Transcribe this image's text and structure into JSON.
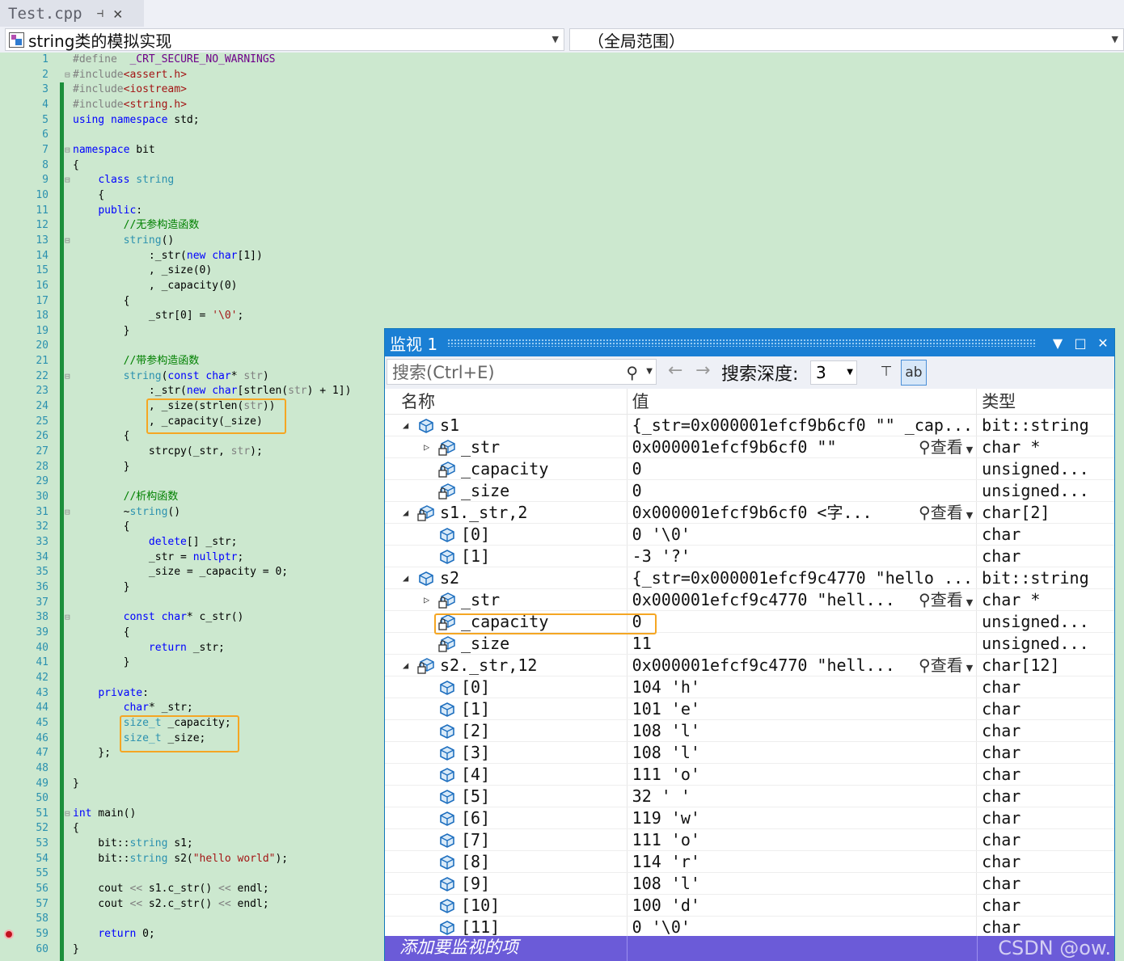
{
  "tab": {
    "title": "Test.cpp",
    "pin": "⊣",
    "close": "✕"
  },
  "nav": {
    "scope": "string类的模拟实现",
    "global": "（全局范围）"
  },
  "code_lines": [
    [
      [
        "p",
        "#define"
      ],
      [
        "",
        "  "
      ],
      [
        "m",
        "_CRT_SECURE_NO_WARNINGS"
      ]
    ],
    [
      [
        "p",
        "#include"
      ],
      [
        "s",
        "<assert.h>"
      ]
    ],
    [
      [
        "p",
        "#include"
      ],
      [
        "s",
        "<iostream>"
      ]
    ],
    [
      [
        "p",
        "#include"
      ],
      [
        "s",
        "<string.h>"
      ]
    ],
    [
      [
        "k",
        "using"
      ],
      [
        "",
        " "
      ],
      [
        "k",
        "namespace"
      ],
      [
        "",
        " std;"
      ]
    ],
    [],
    [
      [
        "k",
        "namespace"
      ],
      [
        "",
        " bit"
      ]
    ],
    [
      [
        "",
        "{"
      ]
    ],
    [
      [
        "",
        "    "
      ],
      [
        "k",
        "class"
      ],
      [
        "",
        " "
      ],
      [
        "t",
        "string"
      ]
    ],
    [
      [
        "",
        "    {"
      ]
    ],
    [
      [
        "",
        "    "
      ],
      [
        "k",
        "public"
      ],
      [
        "",
        ":"
      ]
    ],
    [
      [
        "",
        "        "
      ],
      [
        "c",
        "//无参构造函数"
      ]
    ],
    [
      [
        "",
        "        "
      ],
      [
        "t",
        "string"
      ],
      [
        "",
        "()"
      ]
    ],
    [
      [
        "",
        "            :_str("
      ],
      [
        "k",
        "new"
      ],
      [
        "",
        " "
      ],
      [
        "k",
        "char"
      ],
      [
        "",
        "[1])"
      ]
    ],
    [
      [
        "",
        "            , _size(0)"
      ]
    ],
    [
      [
        "",
        "            , _capacity(0)"
      ]
    ],
    [
      [
        "",
        "        {"
      ]
    ],
    [
      [
        "",
        "            _str[0] = "
      ],
      [
        "s",
        "'\\0'"
      ],
      [
        "",
        ";"
      ]
    ],
    [
      [
        "",
        "        }"
      ]
    ],
    [],
    [
      [
        "",
        "        "
      ],
      [
        "c",
        "//带参构造函数"
      ]
    ],
    [
      [
        "",
        "        "
      ],
      [
        "t",
        "string"
      ],
      [
        "",
        "("
      ],
      [
        "k",
        "const"
      ],
      [
        "",
        " "
      ],
      [
        "k",
        "char"
      ],
      [
        "",
        "* "
      ],
      [
        "g",
        "str"
      ],
      [
        "",
        ")"
      ]
    ],
    [
      [
        "",
        "            :_str("
      ],
      [
        "k",
        "new"
      ],
      [
        "",
        " "
      ],
      [
        "k",
        "char"
      ],
      [
        "",
        "[strlen("
      ],
      [
        "g",
        "str"
      ],
      [
        "",
        ") + 1])"
      ]
    ],
    [
      [
        "",
        "            , _size(strlen("
      ],
      [
        "g",
        "str"
      ],
      [
        "",
        "))"
      ]
    ],
    [
      [
        "",
        "            , _capacity(_size)"
      ]
    ],
    [
      [
        "",
        "        {"
      ]
    ],
    [
      [
        "",
        "            strcpy(_str, "
      ],
      [
        "g",
        "str"
      ],
      [
        "",
        ");"
      ]
    ],
    [
      [
        "",
        "        }"
      ]
    ],
    [],
    [
      [
        "",
        "        "
      ],
      [
        "c",
        "//析构函数"
      ]
    ],
    [
      [
        "",
        "        ~"
      ],
      [
        "t",
        "string"
      ],
      [
        "",
        "()"
      ]
    ],
    [
      [
        "",
        "        {"
      ]
    ],
    [
      [
        "",
        "            "
      ],
      [
        "k",
        "delete"
      ],
      [
        "",
        "[] _str;"
      ]
    ],
    [
      [
        "",
        "            _str = "
      ],
      [
        "k",
        "nullptr"
      ],
      [
        "",
        ";"
      ]
    ],
    [
      [
        "",
        "            _size = _capacity = 0;"
      ]
    ],
    [
      [
        "",
        "        }"
      ]
    ],
    [],
    [
      [
        "",
        "        "
      ],
      [
        "k",
        "const"
      ],
      [
        "",
        " "
      ],
      [
        "k",
        "char"
      ],
      [
        "",
        "* c_str()"
      ]
    ],
    [
      [
        "",
        "        {"
      ]
    ],
    [
      [
        "",
        "            "
      ],
      [
        "k",
        "return"
      ],
      [
        "",
        " _str;"
      ]
    ],
    [
      [
        "",
        "        }"
      ]
    ],
    [],
    [
      [
        "",
        "    "
      ],
      [
        "k",
        "private"
      ],
      [
        "",
        ":"
      ]
    ],
    [
      [
        "",
        "        "
      ],
      [
        "k",
        "char"
      ],
      [
        "",
        "* _str;"
      ]
    ],
    [
      [
        "",
        "        "
      ],
      [
        "t",
        "size_t"
      ],
      [
        "",
        " _capacity;"
      ]
    ],
    [
      [
        "",
        "        "
      ],
      [
        "t",
        "size_t"
      ],
      [
        "",
        " _size;"
      ]
    ],
    [
      [
        "",
        "    };"
      ]
    ],
    [],
    [
      [
        "",
        "}"
      ]
    ],
    [],
    [
      [
        "k",
        "int"
      ],
      [
        "",
        " main()"
      ]
    ],
    [
      [
        "",
        "{"
      ]
    ],
    [
      [
        "",
        "    bit::"
      ],
      [
        "t",
        "string"
      ],
      [
        "",
        " s1;"
      ]
    ],
    [
      [
        "",
        "    bit::"
      ],
      [
        "t",
        "string"
      ],
      [
        "",
        " s2("
      ],
      [
        "s",
        "\"hello world\""
      ],
      [
        "",
        ");"
      ]
    ],
    [],
    [
      [
        "",
        "    cout "
      ],
      [
        "g",
        "<<"
      ],
      [
        "",
        " s1.c_str() "
      ],
      [
        "g",
        "<<"
      ],
      [
        "",
        " endl;"
      ]
    ],
    [
      [
        "",
        "    cout "
      ],
      [
        "g",
        "<<"
      ],
      [
        "",
        " s2.c_str() "
      ],
      [
        "g",
        "<<"
      ],
      [
        "",
        " endl;"
      ]
    ],
    [],
    [
      [
        "",
        "    "
      ],
      [
        "k",
        "return"
      ],
      [
        "",
        " 0;"
      ]
    ],
    [
      [
        "",
        "}"
      ]
    ]
  ],
  "watch": {
    "title": "监视 1",
    "search_placeholder": "搜索(Ctrl+E)",
    "depth_label": "搜索深度:",
    "depth_value": "3",
    "col_name": "名称",
    "col_value": "值",
    "col_type": "类型",
    "view_label": "查看",
    "add_item": "添加要监视的项",
    "watermark": "CSDN @ow.",
    "rows": [
      {
        "indent": 0,
        "exp": "open",
        "icon": "object",
        "name": "s1",
        "value": "{_str=0x000001efcf9b6cf0 \"\" _cap...",
        "type": "bit::string",
        "view": false
      },
      {
        "indent": 1,
        "exp": "closed",
        "icon": "field",
        "name": "_str",
        "value": "0x000001efcf9b6cf0 \"\"",
        "type": "char *",
        "view": true
      },
      {
        "indent": 1,
        "exp": "none",
        "icon": "field",
        "name": "_capacity",
        "value": "0",
        "type": "unsigned...",
        "view": false
      },
      {
        "indent": 1,
        "exp": "none",
        "icon": "field",
        "name": "_size",
        "value": "0",
        "type": "unsigned...",
        "view": false
      },
      {
        "indent": 0,
        "exp": "open",
        "icon": "field",
        "name": "s1._str,2",
        "value": "0x000001efcf9b6cf0 <字...",
        "type": "char[2]",
        "view": true
      },
      {
        "indent": 1,
        "exp": "none",
        "icon": "object",
        "name": "[0]",
        "value": "0 '\\0'",
        "type": "char",
        "view": false
      },
      {
        "indent": 1,
        "exp": "none",
        "icon": "object",
        "name": "[1]",
        "value": "-3 '?'",
        "type": "char",
        "view": false
      },
      {
        "indent": 0,
        "exp": "open",
        "icon": "object",
        "name": "s2",
        "value": "{_str=0x000001efcf9c4770 \"hello ...",
        "type": "bit::string",
        "view": false
      },
      {
        "indent": 1,
        "exp": "closed",
        "icon": "field",
        "name": "_str",
        "value": "0x000001efcf9c4770 \"hell...",
        "type": "char *",
        "view": true
      },
      {
        "indent": 1,
        "exp": "none",
        "icon": "field",
        "name": "_capacity",
        "value": "0",
        "type": "unsigned...",
        "view": false
      },
      {
        "indent": 1,
        "exp": "none",
        "icon": "field",
        "name": "_size",
        "value": "11",
        "type": "unsigned...",
        "view": false
      },
      {
        "indent": 0,
        "exp": "open",
        "icon": "field",
        "name": "s2._str,12",
        "value": "0x000001efcf9c4770 \"hell...",
        "type": "char[12]",
        "view": true
      },
      {
        "indent": 1,
        "exp": "none",
        "icon": "object",
        "name": "[0]",
        "value": "104 'h'",
        "type": "char",
        "view": false
      },
      {
        "indent": 1,
        "exp": "none",
        "icon": "object",
        "name": "[1]",
        "value": "101 'e'",
        "type": "char",
        "view": false
      },
      {
        "indent": 1,
        "exp": "none",
        "icon": "object",
        "name": "[2]",
        "value": "108 'l'",
        "type": "char",
        "view": false
      },
      {
        "indent": 1,
        "exp": "none",
        "icon": "object",
        "name": "[3]",
        "value": "108 'l'",
        "type": "char",
        "view": false
      },
      {
        "indent": 1,
        "exp": "none",
        "icon": "object",
        "name": "[4]",
        "value": "111 'o'",
        "type": "char",
        "view": false
      },
      {
        "indent": 1,
        "exp": "none",
        "icon": "object",
        "name": "[5]",
        "value": "32 ' '",
        "type": "char",
        "view": false
      },
      {
        "indent": 1,
        "exp": "none",
        "icon": "object",
        "name": "[6]",
        "value": "119 'w'",
        "type": "char",
        "view": false
      },
      {
        "indent": 1,
        "exp": "none",
        "icon": "object",
        "name": "[7]",
        "value": "111 'o'",
        "type": "char",
        "view": false
      },
      {
        "indent": 1,
        "exp": "none",
        "icon": "object",
        "name": "[8]",
        "value": "114 'r'",
        "type": "char",
        "view": false
      },
      {
        "indent": 1,
        "exp": "none",
        "icon": "object",
        "name": "[9]",
        "value": "108 'l'",
        "type": "char",
        "view": false
      },
      {
        "indent": 1,
        "exp": "none",
        "icon": "object",
        "name": "[10]",
        "value": "100 'd'",
        "type": "char",
        "view": false
      },
      {
        "indent": 1,
        "exp": "none",
        "icon": "object",
        "name": "[11]",
        "value": "0 '\\0'",
        "type": "char",
        "view": false
      }
    ]
  }
}
